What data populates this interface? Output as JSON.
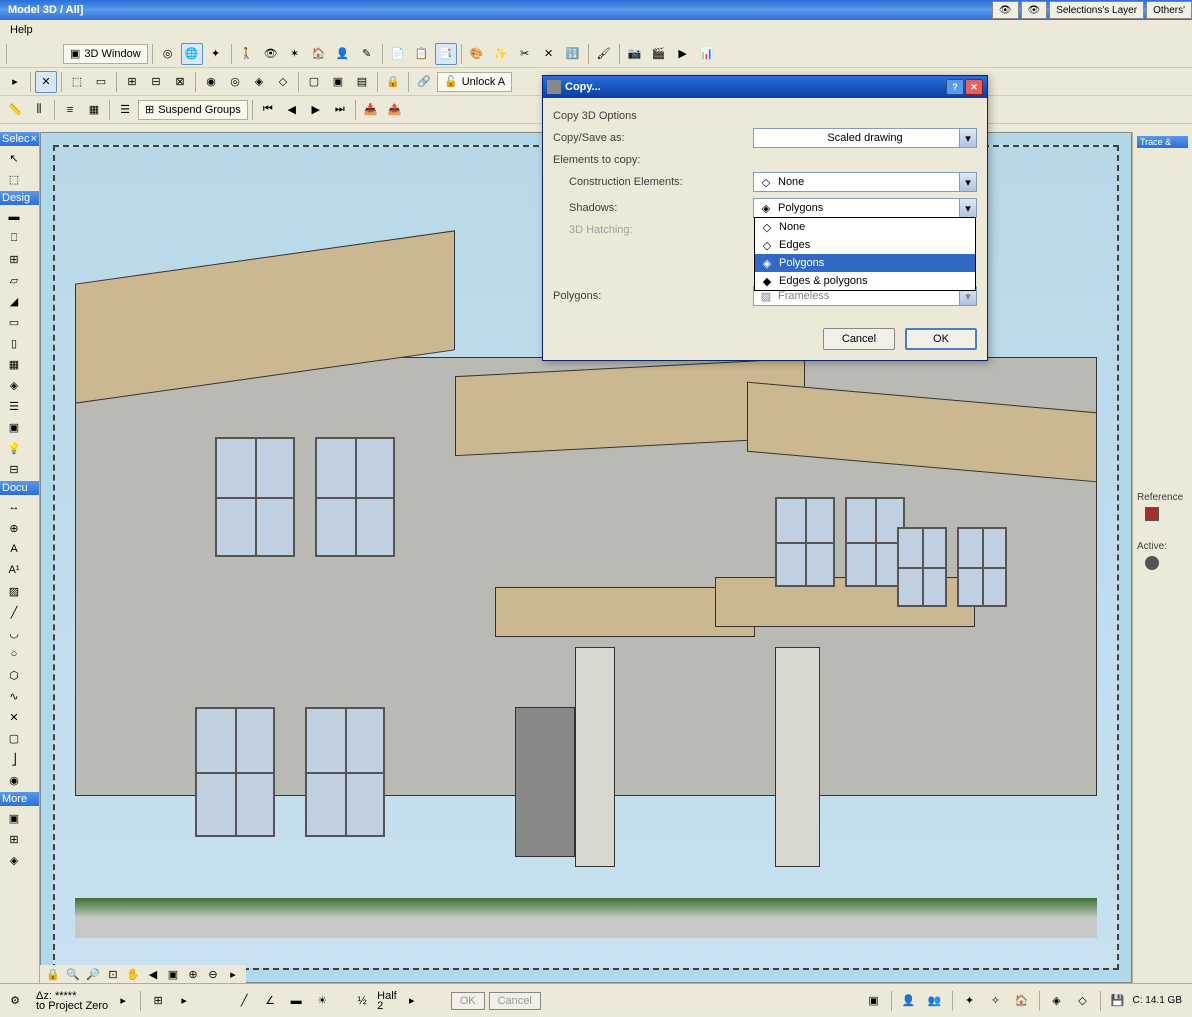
{
  "app": {
    "title": "Model 3D / All]",
    "menu": {
      "help": "Help"
    }
  },
  "topright": {
    "selections_layer": "Selections's Layer",
    "others": "Others'"
  },
  "toolbar1": {
    "window3d": "3D Window",
    "suspend_groups": "Suspend Groups",
    "unlock": "Unlock A"
  },
  "left_toolbox": {
    "select_header": "Selec",
    "design_header": "Desig",
    "docu_header": "Docu",
    "more_header": "More"
  },
  "right_panel": {
    "trace_header": "Trace &",
    "reference_label": "Reference",
    "active_label": "Active:"
  },
  "dialog": {
    "title": "Copy...",
    "section1": "Copy 3D Options",
    "copy_save_as": "Copy/Save as:",
    "copy_save_as_value": "Scaled drawing",
    "elements_to_copy": "Elements to copy:",
    "construction_elements": "Construction Elements:",
    "construction_elements_value": "None",
    "shadows": "Shadows:",
    "shadows_value": "Polygons",
    "hatching_3d": "3D Hatching:",
    "polygons": "Polygons:",
    "polygons_value": "Frameless",
    "dropdown_items": [
      "None",
      "Edges",
      "Polygons",
      "Edges & polygons"
    ],
    "cancel": "Cancel",
    "ok": "OK"
  },
  "statusbar": {
    "dz_label": "Δz:",
    "dz_value": "*****",
    "project_zero": "to Project Zero",
    "half": "Half",
    "half_num": "2",
    "ok": "OK",
    "cancel": "Cancel",
    "disk_label": "C: 14.1 GB"
  }
}
